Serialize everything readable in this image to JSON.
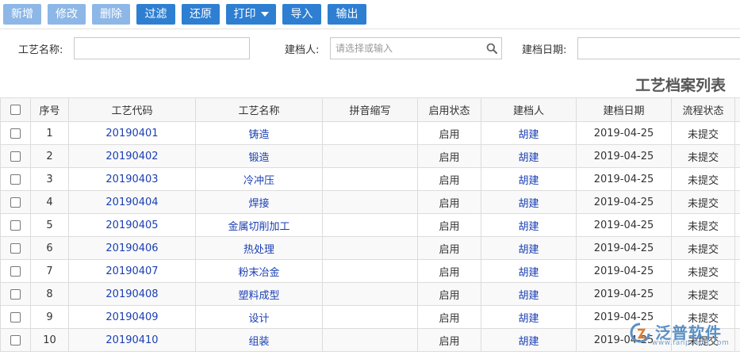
{
  "toolbar": {
    "buttons": [
      {
        "label": "新增",
        "enabled": false
      },
      {
        "label": "修改",
        "enabled": false
      },
      {
        "label": "删除",
        "enabled": false
      },
      {
        "label": "过滤",
        "enabled": true
      },
      {
        "label": "还原",
        "enabled": true
      },
      {
        "label": "打印",
        "enabled": true
      },
      {
        "label": "导入",
        "enabled": true
      },
      {
        "label": "输出",
        "enabled": true
      }
    ]
  },
  "search": {
    "craft_name_label": "工艺名称:",
    "craft_name_value": "",
    "creator_label": "建档人:",
    "creator_placeholder": "请选择或输入",
    "date_label": "建档日期:",
    "date_value": ""
  },
  "page": {
    "title": "工艺档案列表"
  },
  "table": {
    "headers": [
      "序号",
      "工艺代码",
      "工艺名称",
      "拼音缩写",
      "启用状态",
      "建档人",
      "建档日期",
      "流程状态"
    ],
    "rows": [
      {
        "no": "1",
        "code": "20190401",
        "name": "铸造",
        "pinyin": "",
        "status": "启用",
        "creator": "胡建",
        "date": "2019-04-25",
        "flow": "未提交"
      },
      {
        "no": "2",
        "code": "20190402",
        "name": "锻造",
        "pinyin": "",
        "status": "启用",
        "creator": "胡建",
        "date": "2019-04-25",
        "flow": "未提交"
      },
      {
        "no": "3",
        "code": "20190403",
        "name": "冷冲压",
        "pinyin": "",
        "status": "启用",
        "creator": "胡建",
        "date": "2019-04-25",
        "flow": "未提交"
      },
      {
        "no": "4",
        "code": "20190404",
        "name": "焊接",
        "pinyin": "",
        "status": "启用",
        "creator": "胡建",
        "date": "2019-04-25",
        "flow": "未提交"
      },
      {
        "no": "5",
        "code": "20190405",
        "name": "金属切削加工",
        "pinyin": "",
        "status": "启用",
        "creator": "胡建",
        "date": "2019-04-25",
        "flow": "未提交"
      },
      {
        "no": "6",
        "code": "20190406",
        "name": "热处理",
        "pinyin": "",
        "status": "启用",
        "creator": "胡建",
        "date": "2019-04-25",
        "flow": "未提交"
      },
      {
        "no": "7",
        "code": "20190407",
        "name": "粉末冶金",
        "pinyin": "",
        "status": "启用",
        "creator": "胡建",
        "date": "2019-04-25",
        "flow": "未提交"
      },
      {
        "no": "8",
        "code": "20190408",
        "name": "塑料成型",
        "pinyin": "",
        "status": "启用",
        "creator": "胡建",
        "date": "2019-04-25",
        "flow": "未提交"
      },
      {
        "no": "9",
        "code": "20190409",
        "name": "设计",
        "pinyin": "",
        "status": "启用",
        "creator": "胡建",
        "date": "2019-04-25",
        "flow": "未提交"
      },
      {
        "no": "10",
        "code": "20190410",
        "name": "组装",
        "pinyin": "",
        "status": "启用",
        "creator": "胡建",
        "date": "2019-04-25",
        "flow": "未提交"
      }
    ]
  },
  "watermark": {
    "brand": "泛普软件",
    "url": "www.fanpusoft.com"
  },
  "colors": {
    "button_enabled": "#2e7fd2",
    "button_disabled": "#8db7e6",
    "link": "#1a3fb3"
  }
}
